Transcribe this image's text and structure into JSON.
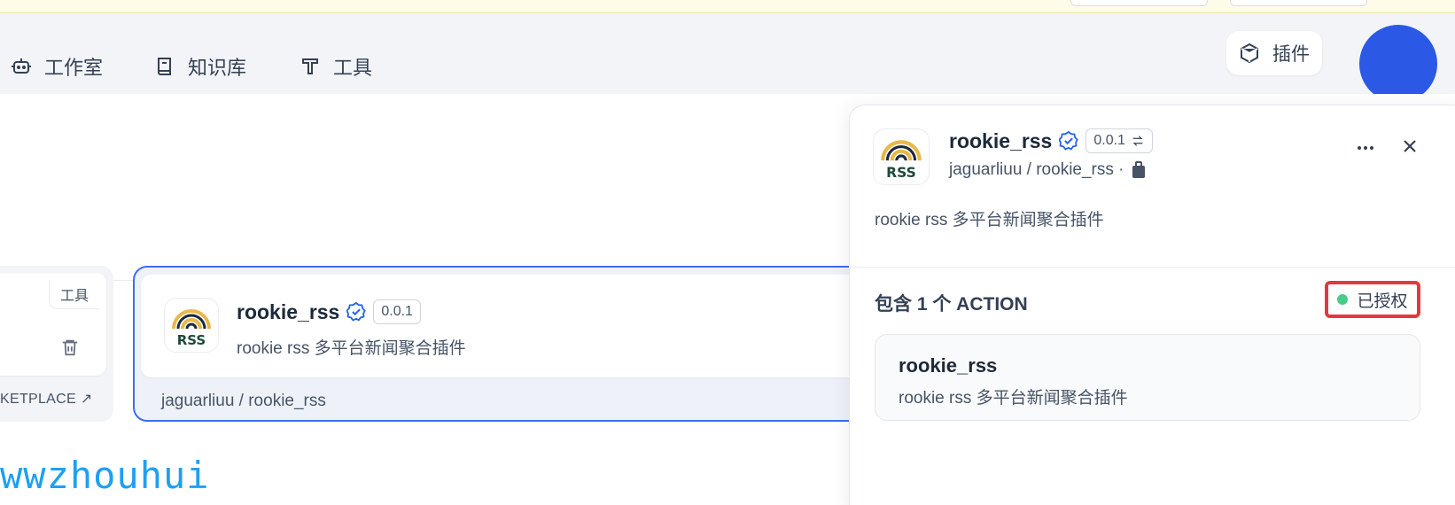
{
  "nav": {
    "items": [
      {
        "label": "工作室",
        "icon": "bot-icon"
      },
      {
        "label": "知识库",
        "icon": "book-icon"
      },
      {
        "label": "工具",
        "icon": "tool-icon"
      }
    ],
    "plugin_label": "插件"
  },
  "left_card": {
    "tag": "工具",
    "marketplace": "KETPLACE ↗"
  },
  "selected_card": {
    "name": "rookie_rss",
    "version": "0.0.1",
    "description": "rookie rss 多平台新闻聚合插件",
    "author": "jaguarliuu / rookie_rss"
  },
  "watermark": "wwzhouhui",
  "panel": {
    "name": "rookie_rss",
    "version": "0.0.1",
    "author": "jaguarliuu / rookie_rss ·",
    "description": "rookie rss 多平台新闻聚合插件",
    "action_title": "包含 1 个 ACTION",
    "auth_status": "已授权",
    "action": {
      "name": "rookie_rss",
      "description": "rookie rss 多平台新闻聚合插件"
    }
  },
  "colors": {
    "accent": "#3b6ef5",
    "avatar": "#2b59e6",
    "authorized": "#47cd89",
    "highlight": "#e5383b",
    "watermark": "#1ea0f0"
  }
}
